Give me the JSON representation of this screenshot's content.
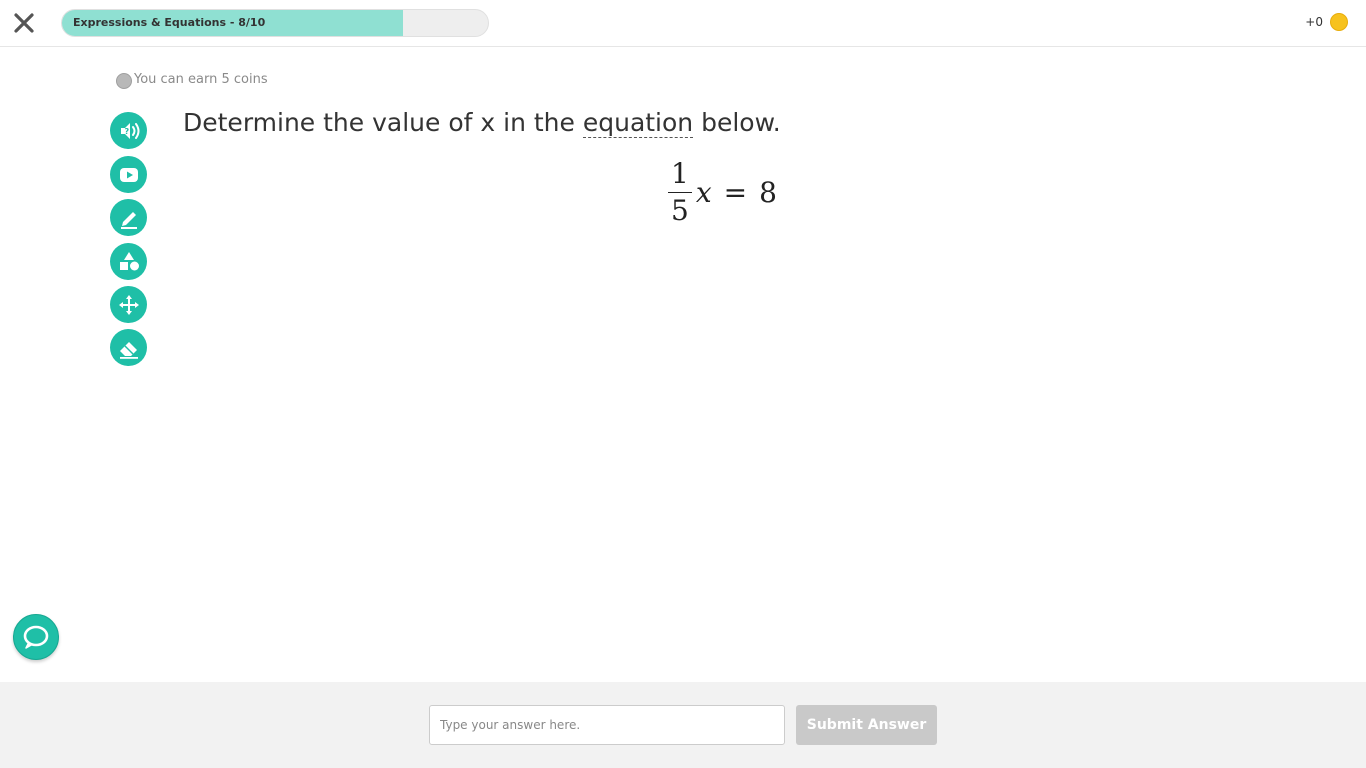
{
  "header": {
    "progress_label": "Expressions & Equations - 8/10",
    "progress_fraction": 0.8,
    "coins_earned": "+0",
    "accent_color": "#1fbfa7",
    "progress_fill_color": "#8fe0d2",
    "coin_color": "#f7c21d"
  },
  "hint": {
    "earn_text": "You can earn 5 coins"
  },
  "tools": [
    {
      "icon": "read-aloud-icon"
    },
    {
      "icon": "video-play-icon"
    },
    {
      "icon": "pencil-icon"
    },
    {
      "icon": "shapes-icon"
    },
    {
      "icon": "move-arrows-icon"
    },
    {
      "icon": "eraser-icon"
    }
  ],
  "question": {
    "text_before": "Determine the value of x in the ",
    "term": "equation",
    "text_after": " below."
  },
  "equation": {
    "numerator": "1",
    "denominator": "5",
    "variable": "x",
    "operator": "=",
    "rhs": "8"
  },
  "footer": {
    "answer_placeholder": "Type your answer here.",
    "submit_label": "Submit Answer"
  }
}
